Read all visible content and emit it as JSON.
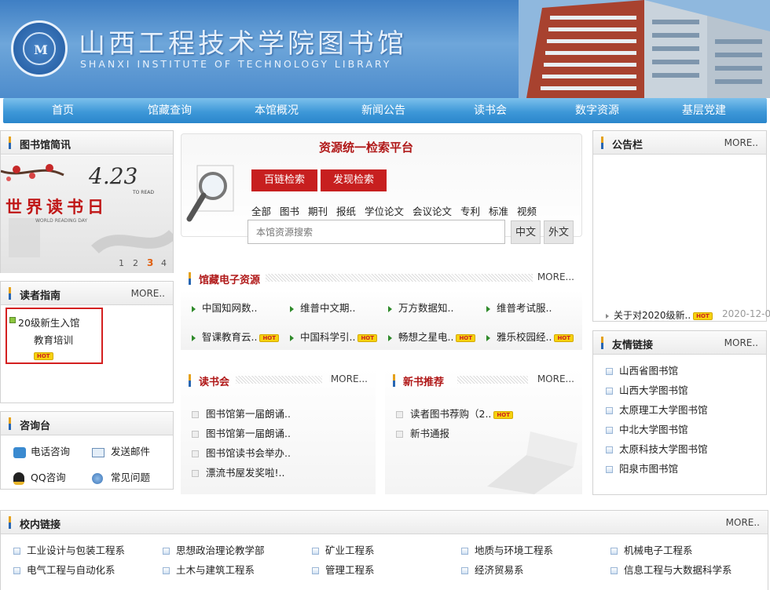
{
  "header": {
    "library_name": "山西工程技术学院图书馆",
    "library_name_en": "SHANXI INSTITUTE OF TECHNOLOGY LIBRARY",
    "logo_letter": "M"
  },
  "nav": [
    "首页",
    "馆藏查询",
    "本馆概况",
    "新闻公告",
    "读书会",
    "数字资源",
    "基层党建"
  ],
  "news": {
    "title": "图书馆简讯",
    "banner_date": "4.23",
    "banner_sub": "TO READ",
    "banner_text": "世界读书日",
    "banner_en": "WORLD READING DAY",
    "pages": [
      "1",
      "2",
      "3",
      "4"
    ],
    "active_page": "3"
  },
  "guide": {
    "title": "读者指南",
    "more": "MORE..",
    "items": [
      "20级新生入馆",
      "教育培训"
    ],
    "hot": "HOT"
  },
  "consult": {
    "title": "咨询台",
    "items": [
      "电话咨询",
      "发送邮件",
      "QQ咨询",
      "常见问题"
    ]
  },
  "search": {
    "title": "资源统一检索平台",
    "buttons": [
      "百链检索",
      "发现检索"
    ],
    "categories": [
      "全部",
      "图书",
      "期刊",
      "报纸",
      "学位论文",
      "会议论文",
      "专利",
      "标准",
      "视频"
    ],
    "placeholder": "本馆资源搜索",
    "lang_buttons": [
      "中文",
      "外文"
    ]
  },
  "eres": {
    "title": "馆藏电子资源",
    "more": "MORE...",
    "items": [
      {
        "label": "中国知网数..",
        "hot": false
      },
      {
        "label": "维普中文期..",
        "hot": false
      },
      {
        "label": "万方数据知..",
        "hot": false
      },
      {
        "label": "维普考试服..",
        "hot": false
      },
      {
        "label": "智课教育云..",
        "hot": true
      },
      {
        "label": "中国科学引..",
        "hot": true
      },
      {
        "label": "畅想之星电..",
        "hot": true
      },
      {
        "label": "雅乐校园经..",
        "hot": true
      }
    ],
    "hot": "HOT"
  },
  "reading_club": {
    "title": "读书会",
    "more": "MORE...",
    "items": [
      "图书馆第一届朗诵..",
      "图书馆第一届朗诵..",
      "图书馆读书会举办..",
      "漂流书屋发奖啦!.."
    ]
  },
  "new_books": {
    "title": "新书推荐",
    "more": "MORE...",
    "items": [
      {
        "label": "读者图书荐购（2..",
        "hot": true
      },
      {
        "label": "新书通报",
        "hot": false
      }
    ],
    "hot": "HOT"
  },
  "notice": {
    "title": "公告栏",
    "more": "MORE..",
    "item": "关于对2020级新..",
    "hot": "HOT",
    "date": "2020-12-0"
  },
  "friends": {
    "title": "友情链接",
    "more": "MORE..",
    "items": [
      "山西省图书馆",
      "山西大学图书馆",
      "太原理工大学图书馆",
      "中北大学图书馆",
      "太原科技大学图书馆",
      "阳泉市图书馆"
    ]
  },
  "campus": {
    "title": "校内链接",
    "more": "MORE..",
    "items": [
      "工业设计与包装工程系",
      "思想政治理论教学部",
      "矿业工程系",
      "地质与环境工程系",
      "机械电子工程系",
      "电气工程与自动化系",
      "土木与建筑工程系",
      "管理工程系",
      "经济贸易系",
      "信息工程与大数据科学系"
    ]
  },
  "colors": {
    "nav": "#2a86cc",
    "accent_red": "#c71f1f",
    "hot_yellow": "#f6d20e",
    "header_blue": "#4d8ccc"
  }
}
